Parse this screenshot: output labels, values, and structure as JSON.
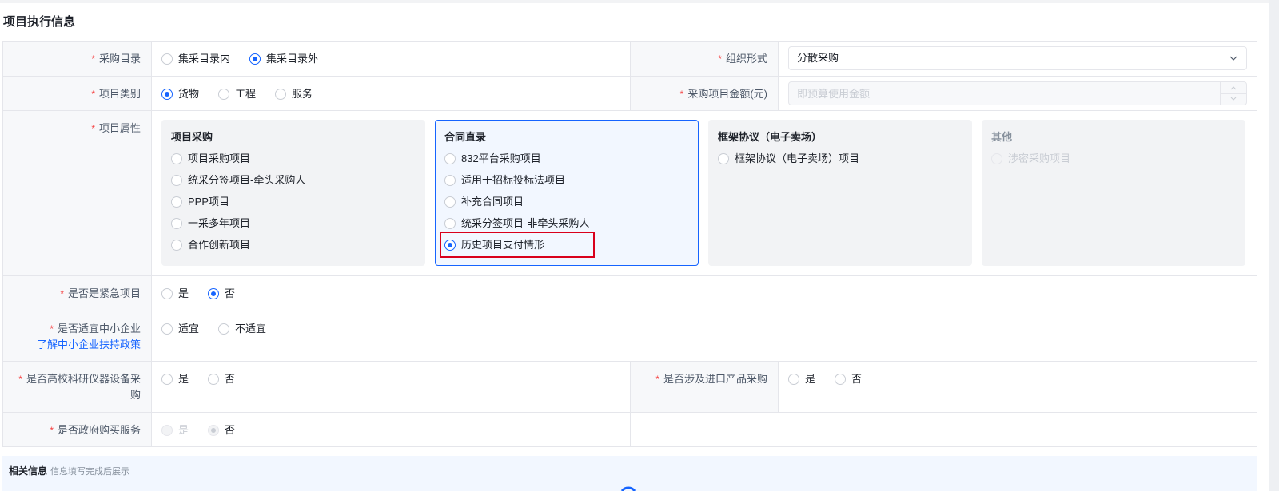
{
  "colors": {
    "accent": "#1664ff",
    "required": "#f53f3f",
    "highlight": "#d9001b"
  },
  "icons": {
    "select": "chevron-down-icon",
    "stepper_up": "chevron-up-icon",
    "stepper_down": "chevron-down-icon",
    "step_indicator": "step-ring-icon"
  },
  "section_title": "项目执行信息",
  "form": {
    "procurement_catalog": {
      "label": "采购目录",
      "required": true,
      "options": [
        {
          "label": "集采目录内",
          "checked": false
        },
        {
          "label": "集采目录外",
          "checked": true
        }
      ]
    },
    "organization_form": {
      "label": "组织形式",
      "required": true,
      "value": "分散采购"
    },
    "project_category": {
      "label": "项目类别",
      "required": true,
      "options": [
        {
          "label": "货物",
          "checked": true
        },
        {
          "label": "工程",
          "checked": false
        },
        {
          "label": "服务",
          "checked": false
        }
      ]
    },
    "procurement_amount": {
      "label": "采购项目金额(元)",
      "required": true,
      "placeholder": "即预算使用金额",
      "disabled": true
    },
    "project_attribute": {
      "label": "项目属性",
      "required": true,
      "groups": [
        {
          "title": "项目采购",
          "selected": false,
          "disabled": false,
          "options": [
            {
              "label": "项目采购项目",
              "checked": false
            },
            {
              "label": "统采分签项目-牵头采购人",
              "checked": false
            },
            {
              "label": "PPP项目",
              "checked": false
            },
            {
              "label": "一采多年项目",
              "checked": false
            },
            {
              "label": "合作创新项目",
              "checked": false
            }
          ]
        },
        {
          "title": "合同直录",
          "selected": true,
          "disabled": false,
          "options": [
            {
              "label": "832平台采购项目",
              "checked": false
            },
            {
              "label": "适用于招标投标法项目",
              "checked": false
            },
            {
              "label": "补充合同项目",
              "checked": false
            },
            {
              "label": "统采分签项目-非牵头采购人",
              "checked": false
            },
            {
              "label": "历史项目支付情形",
              "checked": true,
              "highlighted": true
            }
          ]
        },
        {
          "title": "框架协议（电子卖场）",
          "selected": false,
          "disabled": false,
          "options": [
            {
              "label": "框架协议（电子卖场）项目",
              "checked": false
            }
          ]
        },
        {
          "title": "其他",
          "selected": false,
          "disabled": true,
          "options": [
            {
              "label": "涉密采购项目",
              "checked": false
            }
          ]
        }
      ]
    },
    "is_urgent": {
      "label": "是否是紧急项目",
      "required": true,
      "options": [
        {
          "label": "是",
          "checked": false
        },
        {
          "label": "否",
          "checked": true
        }
      ]
    },
    "sme_suitable": {
      "label": "是否适宜中小企业",
      "required": true,
      "policy_link": "了解中小企业扶持政策",
      "options": [
        {
          "label": "适宜",
          "checked": false
        },
        {
          "label": "不适宜",
          "checked": false
        }
      ]
    },
    "university_research_equipment": {
      "label": "是否高校科研仪器设备采购",
      "required": true,
      "options": [
        {
          "label": "是",
          "checked": false
        },
        {
          "label": "否",
          "checked": false
        }
      ]
    },
    "imported_products": {
      "label": "是否涉及进口产品采购",
      "required": true,
      "options": [
        {
          "label": "是",
          "checked": false
        },
        {
          "label": "否",
          "checked": false
        }
      ]
    },
    "gov_purchased_service": {
      "label": "是否政府购买服务",
      "required": true,
      "disabled": true,
      "options": [
        {
          "label": "是",
          "checked": false
        },
        {
          "label": "否",
          "checked": true
        }
      ]
    }
  },
  "related_info": {
    "title": "相关信息",
    "hint": "信息填写完成后展示"
  }
}
